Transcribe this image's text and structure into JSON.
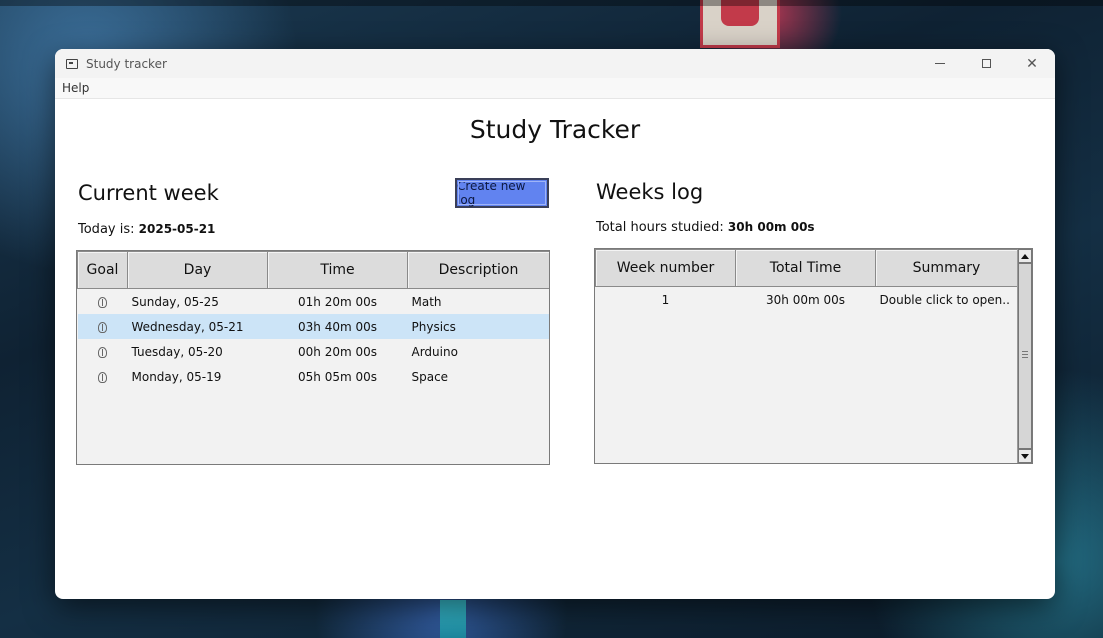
{
  "window": {
    "title": "Study tracker"
  },
  "menu": {
    "items": [
      "Help"
    ]
  },
  "main_title": "Study Tracker",
  "current_week": {
    "title": "Current week",
    "today_label": "Today is:",
    "today_value": "2025-05-21",
    "create_button": "Create new log",
    "columns": [
      "Goal",
      "Day",
      "Time",
      "Description"
    ],
    "rows": [
      {
        "goal_icon": "leaf-icon",
        "day": "Sunday, 05-25",
        "time": "01h 20m 00s",
        "description": "Math"
      },
      {
        "goal_icon": "leaf-icon",
        "day": "Wednesday, 05-21",
        "time": "03h 40m 00s",
        "description": "Physics",
        "selected": true
      },
      {
        "goal_icon": "leaf-icon",
        "day": "Tuesday, 05-20",
        "time": "00h 20m 00s",
        "description": "Arduino"
      },
      {
        "goal_icon": "leaf-icon",
        "day": "Monday, 05-19",
        "time": "05h 05m 00s",
        "description": "Space"
      }
    ]
  },
  "weeks_log": {
    "title": "Weeks log",
    "total_label": "Total hours studied:",
    "total_value": "30h 00m 00s",
    "columns": [
      "Week number",
      "Total Time",
      "Summary"
    ],
    "rows": [
      {
        "week": "1",
        "total": "30h 00m 00s",
        "summary": "Double click to open.."
      }
    ]
  },
  "colors": {
    "accent_button": "#6183f0",
    "selected_row": "#cce4f7",
    "header_bg": "#dcdcdc"
  }
}
